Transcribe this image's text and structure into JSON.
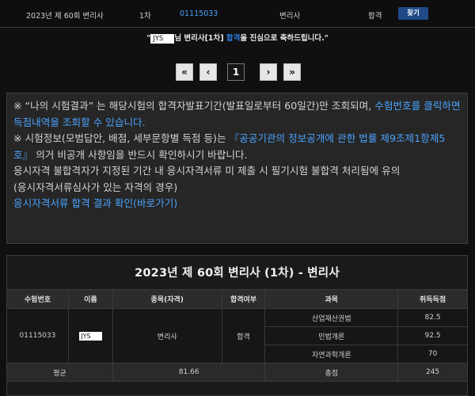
{
  "result_row": {
    "exam": "2023년 제 60회 변리사",
    "round": "1차",
    "exam_number": "01115033",
    "qualification": "변리사",
    "status": "합격",
    "find_button": "찾기"
  },
  "congrats": {
    "quote_open": "\"",
    "name": "JYS",
    "before": "님 변리사[1차] ",
    "pass_word": "합격",
    "after": "을 진심으로 축하드립니다.\""
  },
  "pagination": {
    "first": "«",
    "prev": "‹",
    "current": "1",
    "next": "›",
    "last": "»"
  },
  "notice": {
    "l1_a": "※ “나의 시험결과” 는 해당시험의 합격자발표기간(발표일로부터 60일간)만 조회되며, ",
    "l1_b": "수험번호를 클릭하면 득점내역을 조회할 수 있습니다.",
    "l2_a": "※ 시험정보(모범답안, 배점, 세부문항별 득점 등)는 ",
    "l2_b": "『공공기관의 정보공개에 관한 법률 제9조제1항제5호』",
    "l2_c": " 의거 비공개 사항임을 반드시 확인하시기 바랍니다.",
    "l3": "응시자격 불합격자가 지정된 기간 내 응시자격서류 미 제출 시 필기시험 불합격 처리됨에 유의",
    "l4": "(응시자격서류심사가 있는 자격의 경우)",
    "l5": "응시자격서류 합격 결과 확인(바로가기)"
  },
  "table": {
    "title": "2023년 제 60회 변리사 (1차) - 변리사",
    "headers": [
      "수험번호",
      "이름",
      "종목(자격)",
      "합격여부",
      "과목",
      "취득득점"
    ],
    "exam_number": "01115033",
    "name": "JYS",
    "qualification": "변리사",
    "status": "합격",
    "subjects": [
      {
        "name": "산업재산권법",
        "score": "82.5"
      },
      {
        "name": "민법개론",
        "score": "92.5"
      },
      {
        "name": "자연과학개론",
        "score": "70"
      }
    ],
    "avg_label": "평균",
    "avg_value": "81.66",
    "total_label": "총점",
    "total_value": "245"
  }
}
